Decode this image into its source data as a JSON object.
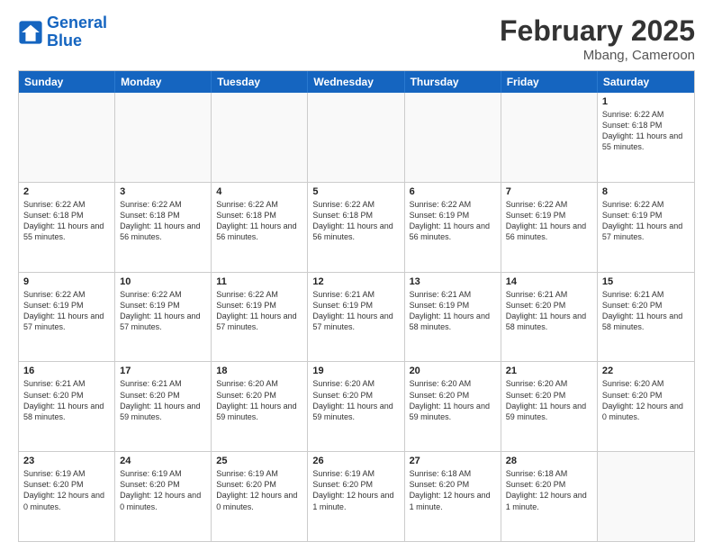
{
  "header": {
    "logo_line1": "General",
    "logo_line2": "Blue",
    "main_title": "February 2025",
    "sub_title": "Mbang, Cameroon"
  },
  "days_of_week": [
    "Sunday",
    "Monday",
    "Tuesday",
    "Wednesday",
    "Thursday",
    "Friday",
    "Saturday"
  ],
  "weeks": [
    [
      {
        "day": "",
        "text": ""
      },
      {
        "day": "",
        "text": ""
      },
      {
        "day": "",
        "text": ""
      },
      {
        "day": "",
        "text": ""
      },
      {
        "day": "",
        "text": ""
      },
      {
        "day": "",
        "text": ""
      },
      {
        "day": "1",
        "text": "Sunrise: 6:22 AM\nSunset: 6:18 PM\nDaylight: 11 hours\nand 55 minutes."
      }
    ],
    [
      {
        "day": "2",
        "text": "Sunrise: 6:22 AM\nSunset: 6:18 PM\nDaylight: 11 hours\nand 55 minutes."
      },
      {
        "day": "3",
        "text": "Sunrise: 6:22 AM\nSunset: 6:18 PM\nDaylight: 11 hours\nand 56 minutes."
      },
      {
        "day": "4",
        "text": "Sunrise: 6:22 AM\nSunset: 6:18 PM\nDaylight: 11 hours\nand 56 minutes."
      },
      {
        "day": "5",
        "text": "Sunrise: 6:22 AM\nSunset: 6:18 PM\nDaylight: 11 hours\nand 56 minutes."
      },
      {
        "day": "6",
        "text": "Sunrise: 6:22 AM\nSunset: 6:19 PM\nDaylight: 11 hours\nand 56 minutes."
      },
      {
        "day": "7",
        "text": "Sunrise: 6:22 AM\nSunset: 6:19 PM\nDaylight: 11 hours\nand 56 minutes."
      },
      {
        "day": "8",
        "text": "Sunrise: 6:22 AM\nSunset: 6:19 PM\nDaylight: 11 hours\nand 57 minutes."
      }
    ],
    [
      {
        "day": "9",
        "text": "Sunrise: 6:22 AM\nSunset: 6:19 PM\nDaylight: 11 hours\nand 57 minutes."
      },
      {
        "day": "10",
        "text": "Sunrise: 6:22 AM\nSunset: 6:19 PM\nDaylight: 11 hours\nand 57 minutes."
      },
      {
        "day": "11",
        "text": "Sunrise: 6:22 AM\nSunset: 6:19 PM\nDaylight: 11 hours\nand 57 minutes."
      },
      {
        "day": "12",
        "text": "Sunrise: 6:21 AM\nSunset: 6:19 PM\nDaylight: 11 hours\nand 57 minutes."
      },
      {
        "day": "13",
        "text": "Sunrise: 6:21 AM\nSunset: 6:19 PM\nDaylight: 11 hours\nand 58 minutes."
      },
      {
        "day": "14",
        "text": "Sunrise: 6:21 AM\nSunset: 6:20 PM\nDaylight: 11 hours\nand 58 minutes."
      },
      {
        "day": "15",
        "text": "Sunrise: 6:21 AM\nSunset: 6:20 PM\nDaylight: 11 hours\nand 58 minutes."
      }
    ],
    [
      {
        "day": "16",
        "text": "Sunrise: 6:21 AM\nSunset: 6:20 PM\nDaylight: 11 hours\nand 58 minutes."
      },
      {
        "day": "17",
        "text": "Sunrise: 6:21 AM\nSunset: 6:20 PM\nDaylight: 11 hours\nand 59 minutes."
      },
      {
        "day": "18",
        "text": "Sunrise: 6:20 AM\nSunset: 6:20 PM\nDaylight: 11 hours\nand 59 minutes."
      },
      {
        "day": "19",
        "text": "Sunrise: 6:20 AM\nSunset: 6:20 PM\nDaylight: 11 hours\nand 59 minutes."
      },
      {
        "day": "20",
        "text": "Sunrise: 6:20 AM\nSunset: 6:20 PM\nDaylight: 11 hours\nand 59 minutes."
      },
      {
        "day": "21",
        "text": "Sunrise: 6:20 AM\nSunset: 6:20 PM\nDaylight: 11 hours\nand 59 minutes."
      },
      {
        "day": "22",
        "text": "Sunrise: 6:20 AM\nSunset: 6:20 PM\nDaylight: 12 hours\nand 0 minutes."
      }
    ],
    [
      {
        "day": "23",
        "text": "Sunrise: 6:19 AM\nSunset: 6:20 PM\nDaylight: 12 hours\nand 0 minutes."
      },
      {
        "day": "24",
        "text": "Sunrise: 6:19 AM\nSunset: 6:20 PM\nDaylight: 12 hours\nand 0 minutes."
      },
      {
        "day": "25",
        "text": "Sunrise: 6:19 AM\nSunset: 6:20 PM\nDaylight: 12 hours\nand 0 minutes."
      },
      {
        "day": "26",
        "text": "Sunrise: 6:19 AM\nSunset: 6:20 PM\nDaylight: 12 hours\nand 1 minute."
      },
      {
        "day": "27",
        "text": "Sunrise: 6:18 AM\nSunset: 6:20 PM\nDaylight: 12 hours\nand 1 minute."
      },
      {
        "day": "28",
        "text": "Sunrise: 6:18 AM\nSunset: 6:20 PM\nDaylight: 12 hours\nand 1 minute."
      },
      {
        "day": "",
        "text": ""
      }
    ]
  ]
}
